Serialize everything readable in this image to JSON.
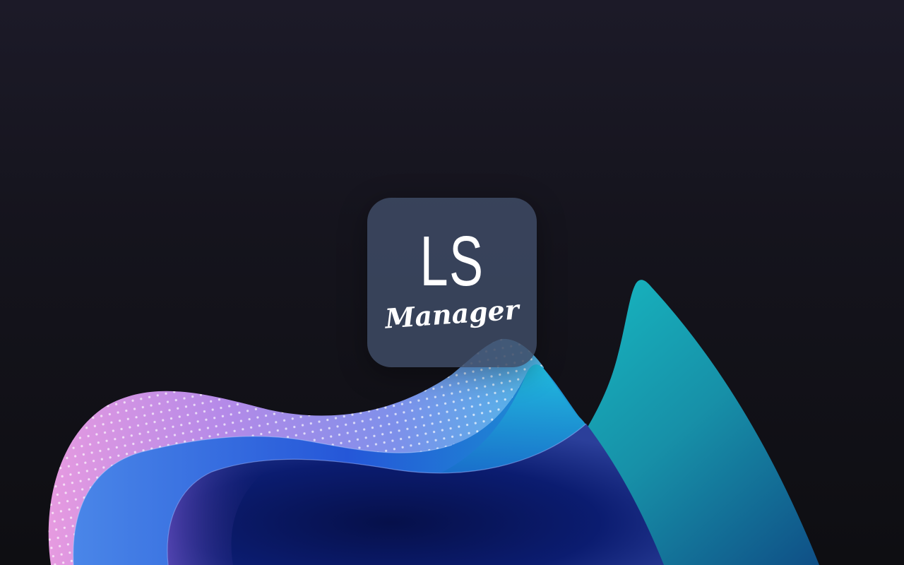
{
  "app": {
    "logo_abbrev": "LS",
    "logo_name": "Manager"
  },
  "icons": {
    "app_tile": "ls-manager-app-icon"
  },
  "colors": {
    "background_top": "#1c1a28",
    "background_bottom": "#0e0e12",
    "tile": "#3e4a64",
    "wave_pink": "#d58fe0",
    "wave_blue": "#2f6fe0",
    "wave_teal": "#16b3be",
    "wave_navy": "#0a1455"
  }
}
